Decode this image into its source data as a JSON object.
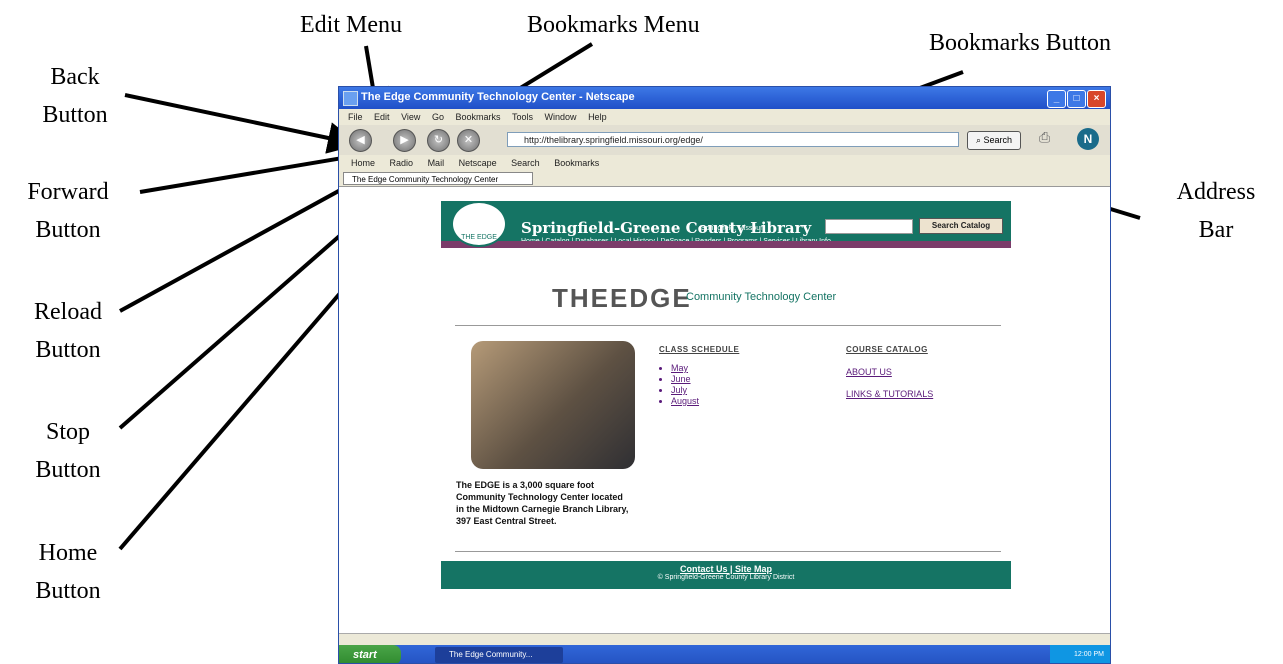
{
  "callouts": {
    "back": [
      "Back",
      "Button"
    ],
    "edit_menu": "Edit Menu",
    "bookmarks_menu": "Bookmarks Menu",
    "bookmarks_button": "Bookmarks Button",
    "forward": [
      "Forward",
      "Button"
    ],
    "address": [
      "Address",
      "Bar"
    ],
    "reload": [
      "Reload",
      "Button"
    ],
    "stop": [
      "Stop",
      "Button"
    ],
    "home": [
      "Home",
      "Button"
    ]
  },
  "browser": {
    "title": "The Edge Community Technology Center - Netscape",
    "menus": [
      "File",
      "Edit",
      "View",
      "Go",
      "Bookmarks",
      "Tools",
      "Window",
      "Help"
    ],
    "address": "http://thelibrary.springfield.missouri.org/edge/",
    "search_label": "Search",
    "personal_bar": [
      "Home",
      "Radio",
      "Mail",
      "Netscape",
      "Search",
      "Bookmarks"
    ],
    "tab": "The Edge Community Technology Center"
  },
  "site": {
    "library_name": "Springfield-Greene County Library",
    "city": "Springfield, Missouri",
    "nav": "Home | Catalog | Databases | Local History | DeSpace | Readers | Programs | Services | Library Info",
    "catalog_button": "Search Catalog",
    "logo_small": "THE EDGE",
    "edge_title": "THEEDGE",
    "edge_subtitle": "Community Technology Center",
    "description": "The EDGE is a 3,000 square foot Community Technology Center located in the Midtown Carnegie Branch Library, 397 East Central Street.",
    "class_schedule": "CLASS SCHEDULE",
    "months": [
      "May",
      "June",
      "July",
      "August"
    ],
    "course_catalog": "COURSE CATALOG",
    "about_us": "ABOUT US",
    "links_tutorials": "LINKS & TUTORIALS",
    "footer_links": "Contact Us | Site Map",
    "footer_copyright": "© Springfield-Greene County Library District"
  },
  "taskbar": {
    "start": "start",
    "task": "The Edge Community...",
    "clock": "12:00 PM"
  },
  "colors": {
    "banner": "#157464",
    "banner_sub": "#7b3c6a",
    "titlebar": "#1f4fc8"
  }
}
